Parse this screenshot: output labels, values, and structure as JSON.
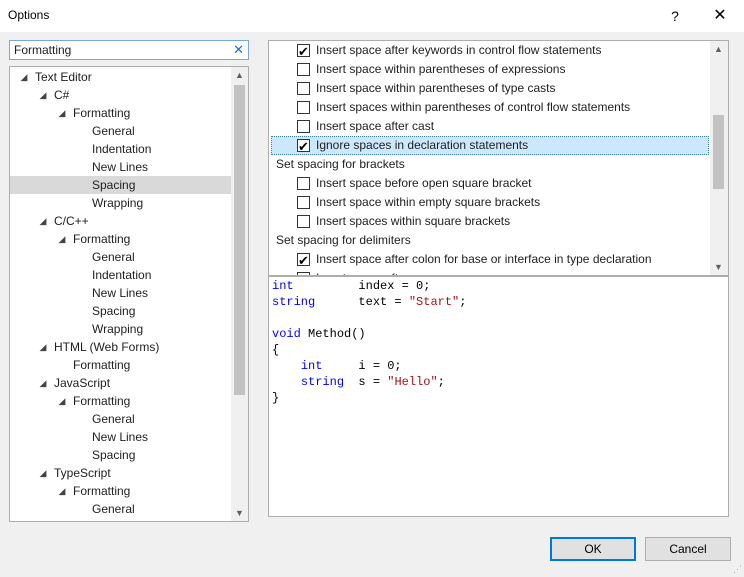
{
  "window": {
    "title": "Options",
    "help_glyph": "?",
    "close_glyph": "✕"
  },
  "search": {
    "value": "Formatting",
    "clear_glyph": "✕"
  },
  "tree": {
    "items": [
      {
        "label": "Text Editor",
        "level": 0,
        "expanded": true
      },
      {
        "label": "C#",
        "level": 1,
        "expanded": true
      },
      {
        "label": "Formatting",
        "level": 2,
        "expanded": true
      },
      {
        "label": "General",
        "level": 3
      },
      {
        "label": "Indentation",
        "level": 3
      },
      {
        "label": "New Lines",
        "level": 3
      },
      {
        "label": "Spacing",
        "level": 3,
        "selected": true
      },
      {
        "label": "Wrapping",
        "level": 3
      },
      {
        "label": "C/C++",
        "level": 1,
        "expanded": true
      },
      {
        "label": "Formatting",
        "level": 2,
        "expanded": true
      },
      {
        "label": "General",
        "level": 3
      },
      {
        "label": "Indentation",
        "level": 3
      },
      {
        "label": "New Lines",
        "level": 3
      },
      {
        "label": "Spacing",
        "level": 3
      },
      {
        "label": "Wrapping",
        "level": 3
      },
      {
        "label": "HTML (Web Forms)",
        "level": 1,
        "expanded": true
      },
      {
        "label": "Formatting",
        "level": 2
      },
      {
        "label": "JavaScript",
        "level": 1,
        "expanded": true
      },
      {
        "label": "Formatting",
        "level": 2,
        "expanded": true
      },
      {
        "label": "General",
        "level": 3
      },
      {
        "label": "New Lines",
        "level": 3
      },
      {
        "label": "Spacing",
        "level": 3
      },
      {
        "label": "TypeScript",
        "level": 1,
        "expanded": true
      },
      {
        "label": "Formatting",
        "level": 2,
        "expanded": true
      },
      {
        "label": "General",
        "level": 3
      }
    ]
  },
  "options": {
    "rows": [
      {
        "kind": "opt",
        "label": "Insert space after keywords in control flow statements",
        "checked": true
      },
      {
        "kind": "opt",
        "label": "Insert space within parentheses of expressions",
        "checked": false
      },
      {
        "kind": "opt",
        "label": "Insert space within parentheses of type casts",
        "checked": false
      },
      {
        "kind": "opt",
        "label": "Insert spaces within parentheses of control flow statements",
        "checked": false
      },
      {
        "kind": "opt",
        "label": "Insert space after cast",
        "checked": false
      },
      {
        "kind": "opt",
        "label": "Ignore spaces in declaration statements",
        "checked": true,
        "focused": true
      },
      {
        "kind": "group",
        "label": "Set spacing for brackets"
      },
      {
        "kind": "opt",
        "label": "Insert space before open square bracket",
        "checked": false
      },
      {
        "kind": "opt",
        "label": "Insert space within empty square brackets",
        "checked": false
      },
      {
        "kind": "opt",
        "label": "Insert spaces within square brackets",
        "checked": false
      },
      {
        "kind": "group",
        "label": "Set spacing for delimiters"
      },
      {
        "kind": "opt",
        "label": "Insert space after colon for base or interface in type declaration",
        "checked": true
      },
      {
        "kind": "opt",
        "label": "Insert space after comma",
        "checked": false
      }
    ]
  },
  "preview": {
    "lines": [
      [
        {
          "t": "int",
          "c": "kw"
        },
        {
          "t": "         index = 0;",
          "c": ""
        }
      ],
      [
        {
          "t": "string",
          "c": "kw"
        },
        {
          "t": "      text = ",
          "c": ""
        },
        {
          "t": "\"Start\"",
          "c": "str"
        },
        {
          "t": ";",
          "c": ""
        }
      ],
      [],
      [
        {
          "t": "void",
          "c": "kw"
        },
        {
          "t": " Method()",
          "c": ""
        }
      ],
      [
        {
          "t": "{",
          "c": ""
        }
      ],
      [
        {
          "t": "    ",
          "c": ""
        },
        {
          "t": "int",
          "c": "kw"
        },
        {
          "t": "     i = 0;",
          "c": ""
        }
      ],
      [
        {
          "t": "    ",
          "c": ""
        },
        {
          "t": "string",
          "c": "kw"
        },
        {
          "t": "  s = ",
          "c": ""
        },
        {
          "t": "\"Hello\"",
          "c": "str"
        },
        {
          "t": ";",
          "c": ""
        }
      ],
      [
        {
          "t": "}",
          "c": ""
        }
      ]
    ]
  },
  "buttons": {
    "ok": "OK",
    "cancel": "Cancel"
  },
  "colors": {
    "accent": "#0078d7",
    "selection": "#cce8ff",
    "keyword": "#0000ff",
    "string": "#a31515"
  }
}
